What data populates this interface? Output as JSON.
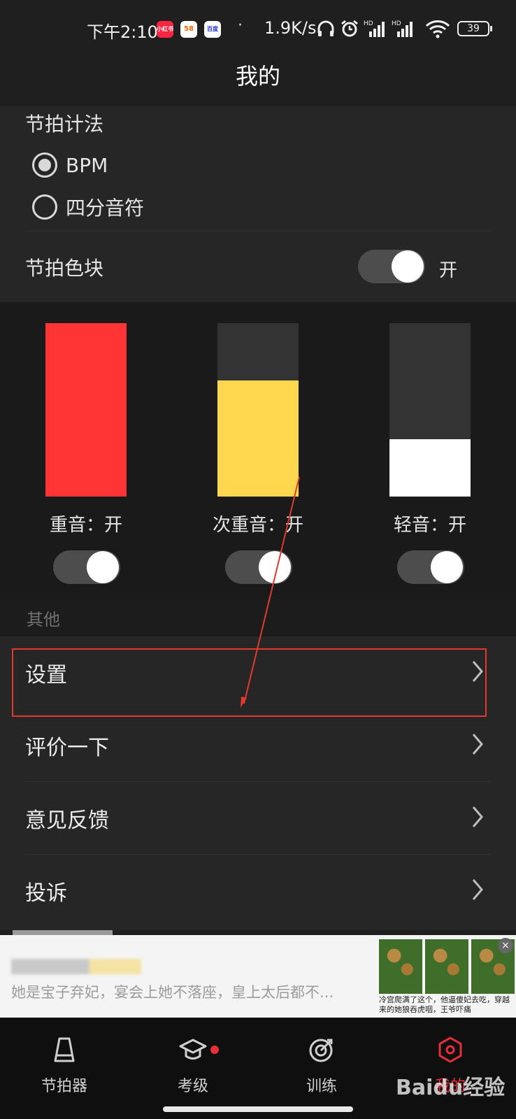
{
  "status_bar": {
    "time": "下午2:10",
    "apps": [
      "小红书",
      "58",
      "百度"
    ],
    "dot": "·",
    "net_speed": "1.9K/s",
    "battery": "39"
  },
  "header": {
    "title": "我的"
  },
  "beat_counting": {
    "title": "节拍计法",
    "options": [
      {
        "label": "BPM",
        "selected": true
      },
      {
        "label": "四分音符",
        "selected": false
      }
    ]
  },
  "beat_color_block": {
    "label": "节拍色块",
    "state_text": "开",
    "on": true
  },
  "color_blocks": [
    {
      "label": "重音：开",
      "color": "#ff3535",
      "fill": 1.0,
      "on": true
    },
    {
      "label": "次重音：开",
      "color": "#ffd84f",
      "fill": 0.67,
      "on": true
    },
    {
      "label": "轻音：开",
      "color": "#ffffff",
      "fill": 0.33,
      "on": true
    }
  ],
  "others": {
    "header": "其他",
    "items": [
      {
        "label": "设置"
      },
      {
        "label": "评价一下"
      },
      {
        "label": "意见反馈"
      },
      {
        "label": "投诉"
      }
    ]
  },
  "ad": {
    "description": "她是宝子弃妃，宴会上她不落座，皇上太后都不...",
    "image_caption": "冷宫爬满了这个，他逼傻妃去吃，穿越来的她狼吞虎咽，王爷吓痛",
    "close": "×"
  },
  "tabbar": {
    "tabs": [
      {
        "label": "节拍器",
        "icon": "metronome-icon"
      },
      {
        "label": "考级",
        "icon": "graduation-cap-icon",
        "badge": true
      },
      {
        "label": "训练",
        "icon": "target-icon"
      },
      {
        "label": "我的",
        "icon": "hexagon-settings-icon",
        "active": true
      }
    ]
  },
  "watermark": "Baidu经验",
  "colors": {
    "accent": "#e5303a",
    "highlight_box": "#e03a2f"
  }
}
